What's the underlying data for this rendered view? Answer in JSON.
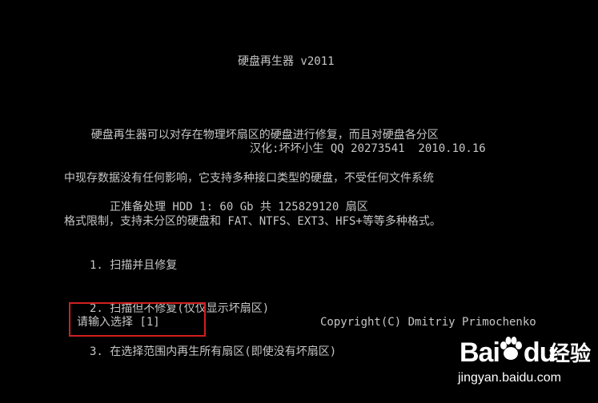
{
  "screen": {
    "title": "硬盘再生器 v2011",
    "description_lines": [
      "    硬盘再生器可以对存在物理坏扇区的硬盘进行修复，而且对硬盘各分区",
      "中现存数据没有任何影响，它支持多种接口类型的硬盘，不受任何文件系统",
      "格式限制，支持未分区的硬盘和 FAT、NTFS、EXT3、HFS+等等多种格式。"
    ],
    "credit": "汉化:坏坏小生 QQ 20273541  2010.10.16",
    "hdd_status": "正准备处理 HDD 1: 60 Gb 共 125829120 扇区",
    "menu": [
      "1. 扫描并且修复",
      "2. 扫描但不修复(仅仅显示坏扇区)",
      "3. 在选择范围内再生所有扇区(即使没有坏扇区)"
    ],
    "prompt": "请输入选择 [1]",
    "copyright": "Copyright(C) Dmitriy Primochenko"
  },
  "watermark": {
    "logo": "Bai",
    "logo_suffix": "du",
    "chinese": "经验",
    "url": "jingyan.baidu.com"
  },
  "colors": {
    "background": "#000000",
    "text": "#c6c6c6",
    "highlight_box": "#d11f1f"
  }
}
